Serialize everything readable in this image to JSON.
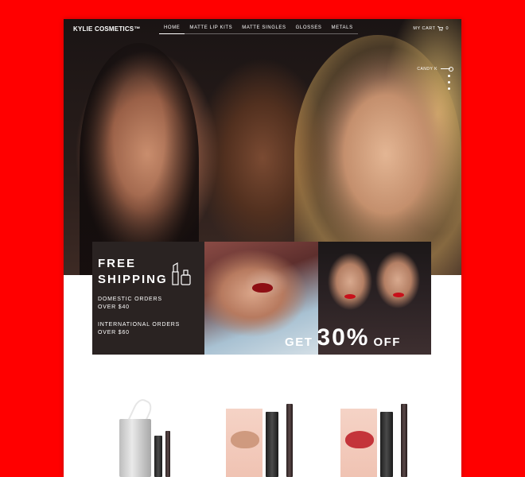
{
  "header": {
    "logo": "KYLIE COSMETICS™",
    "nav": [
      {
        "label": "HOME",
        "active": true
      },
      {
        "label": "MATTE LIP KITS",
        "active": false
      },
      {
        "label": "MATTE SINGLES",
        "active": false
      },
      {
        "label": "GLOSSES",
        "active": false
      },
      {
        "label": "METALS",
        "active": false
      }
    ],
    "cart_label": "MY CART",
    "cart_count": "0",
    "cart_icon": "cart-icon"
  },
  "hero": {
    "slide_label": "CANDY K",
    "slide_dots": 3
  },
  "promo": {
    "shipping_title_1": "FREE",
    "shipping_title_2": "SHIPPING",
    "shipping_icon": "lipstick-bottle-icon",
    "domestic_1": "DOMESTIC ORDERS",
    "domestic_2": "OVER $40",
    "international_1": "INTERNATIONAL ORDERS",
    "international_2": "OVER $60",
    "discount_pre": "GET",
    "discount_value": "30%",
    "discount_post": "OFF"
  },
  "colors": {
    "background": "#ff0000",
    "page": "#ffffff",
    "shipping_panel": "#2a2322",
    "text_light": "#ffffff"
  }
}
